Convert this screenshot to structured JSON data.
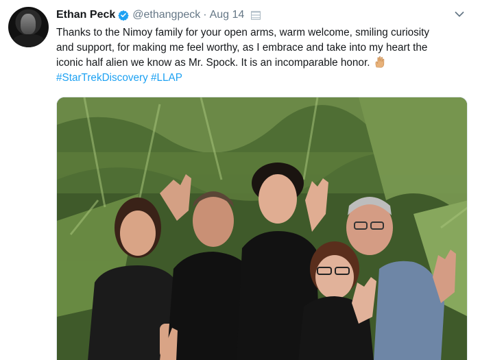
{
  "tweet": {
    "author_name": "Ethan Peck",
    "handle": "@ethangpeck",
    "separator": "·",
    "date": "Aug 14",
    "text_lines": [
      "Thanks to the Nimoy family for your open arms, warm welcome, smiling curiosity",
      "and support, for making me feel worthy, as I embrace and take into my heart the",
      "iconic half alien we know as Mr. Spock. It is an incomparable honor."
    ],
    "hashtags": [
      "#StarTrekDiscovery",
      "#LLAP"
    ],
    "emoji": "vulcan-salute-icon"
  },
  "colors": {
    "text": "#14171a",
    "muted": "#657786",
    "link": "#1da1f2",
    "verified": "#1da1f2"
  }
}
